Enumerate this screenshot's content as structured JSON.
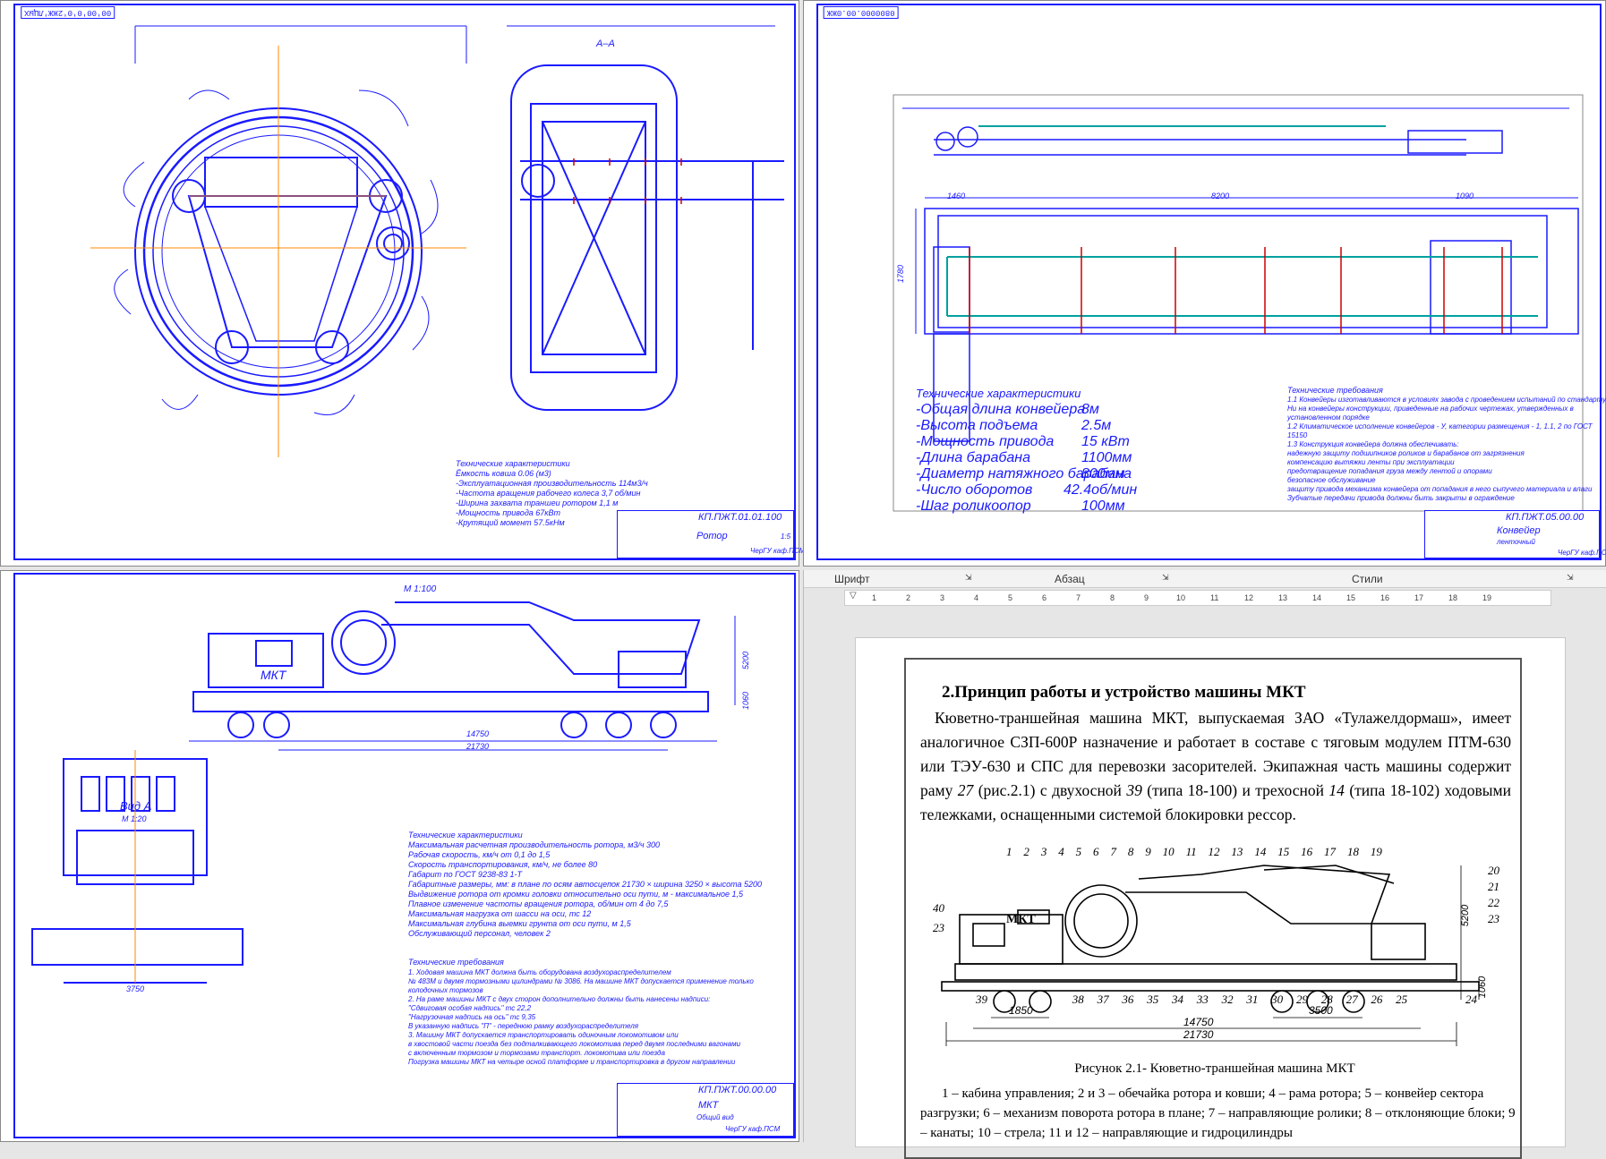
{
  "sheet1": {
    "stamp": "00'00'0'0'2ЖЖ'ЛЦЫХ",
    "section_label": "А–А",
    "title_code": "КП.ПЖТ.01.01.100",
    "title_name": "Ротор",
    "sheet_info": "ЧерГУ каф.ПСМ",
    "scale": "1:5",
    "specs_heading": "Технические характеристики",
    "specs": [
      "Ёмкость ковша     0.06 (м3)",
      "-Эксплуатационная производительность   114м3/ч",
      "-Частота вращения рабочего колеса 3,7 об/мин",
      "-Ширина захвата траншеи ротором 1,1 м",
      "-Мощность привода 67кВт",
      "-Крутящий момент 57.5кНм"
    ]
  },
  "sheet2": {
    "stamp": "0800000.00.0ЖЖ",
    "title_code": "КП.ПЖТ.05.00.00",
    "title_name": "Конвейер",
    "title_sub": "ленточный",
    "sheet_info": "ЧерГУ каф.ПСМ",
    "specs_heading": "Технические характеристики",
    "specs_rows": [
      {
        "label": "-Общая длина конвейера",
        "value": "8м"
      },
      {
        "label": "-Высота подъема",
        "value": "2.5м"
      },
      {
        "label": "-Мощность привода",
        "value": "15 кВт"
      },
      {
        "label": "-Длина барабана",
        "value": "1100мм"
      },
      {
        "label": "-Диаметр натяжного барабана",
        "value": "800мм"
      },
      {
        "label": "-Число оборотов",
        "value": "42.4об/мин"
      },
      {
        "label": "-Шаг роликоопор",
        "value": "100мм"
      }
    ],
    "req_heading": "Технические требования",
    "requirements": [
      "1.1 Конвейеры изготавливаются в условиях завода с проведением испытаний по стандарту и",
      "Ни на конвейеры конструкции, приведенные на рабочих чертежах, утвержденных в",
      "установленном порядке",
      "1.2 Климатическое исполнение конвейеров - У, категории размещения - 1, 1.1, 2 по ГОСТ",
      "15150",
      "1.3 Конструкция конвейера должна обеспечивать:",
      "надежную защиту подшипников роликов и барабанов от загрязнения",
      "компенсацию вытяжки ленты при эксплуатации",
      "предотвращение попадания груза между лентой и опорами",
      "безопасное обслуживание",
      "защиту привода механизма конвейера от попадания в него сыпучего материала и влаги",
      "Зубчатые передачи привода должны быть закрыты в ограждение"
    ],
    "dims": {
      "total": "8200",
      "left": "1460",
      "right": "1090",
      "height": "1780"
    }
  },
  "sheet3": {
    "top_scale": "М 1:100",
    "machine_label": "МКТ",
    "view_label": "Вид А",
    "view_scale": "М 1:20",
    "dims": {
      "total": "21730",
      "base": "14750",
      "height": "5200",
      "wheel": "1060",
      "view_width": "3750"
    },
    "title_code": "КП.ПЖТ.00.00.00",
    "title_name": "МКТ",
    "title_sub": "Общий вид",
    "sheet_info": "ЧерГУ каф.ПСМ",
    "specs_heading": "Технические характеристики",
    "specs": [
      "Максимальная расчетная производительность ротора, м3/ч 300",
      "Рабочая скорость, км/ч от 0,1 до 1,5",
      "Скорость транспортирования, км/ч, не более 80",
      "Габарит по ГОСТ 9238-83 1-Т",
      "Габаритные размеры, мм: в плане по осям автосцепок 21730 × ширина 3250 × высота 5200",
      "Выдвижение ротора от кромки головки относительно оси пути, м - максимальное 1,5",
      "Плавное изменение частоты вращения ротора, об/мин от 4 до 7,5",
      "Максимальная нагрузка от шасси на оси, тс 12",
      "Максимальная глубина выемки грунта от оси пути, м 1,5",
      "Обслуживающий персонал, человек   2"
    ],
    "req_heading": "Технические требования",
    "requirements": [
      "1. Ходовая машина МКТ должна быть оборудована воздухораспределителем",
      "№ 483М и двумя тормозными цилиндрами № 3086. На машине МКТ допускается применение только",
      "колодочных тормозов",
      "2. На раме машины МКТ с двух сторон дополнительно должны быть нанесены надписи:",
      "\"Сдвиговая особая надпись\"        тс 22,2",
      "\"Нагрузочная надпись на ось\"       тс 9,35",
      "В указанную надпись \"П\" - переднюю рамку воздухораспределителя",
      "3. Машину МКТ допускается транспортировать одиночным локомотивом или",
      "в хвостовой части поезда без подталкивающего локомотива перед двумя последними вагонами",
      "с включенным тормозом и тормозами транспорт. локомотива или поезда",
      "Погрузка машины МКТ на четыре осной платформе и транспортировка в другом направлении"
    ]
  },
  "word": {
    "ribbon": {
      "font": "Шрифт",
      "paragraph": "Абзац",
      "styles": "Стили"
    },
    "ruler_ticks": [
      "1",
      "2",
      "3",
      "4",
      "5",
      "6",
      "7",
      "8",
      "9",
      "10",
      "11",
      "12",
      "13",
      "14",
      "15",
      "16",
      "17",
      "18",
      "19"
    ],
    "heading": "2.Принцип работы и устройство машины МКТ",
    "paragraph_parts": [
      "Кюветно-траншейная машина МКТ, выпускаемая ЗАО «Тулажелдормаш», имеет аналогичное СЗП-600Р назначение и работает в составе с тяговым модулем ПТМ-630 или ТЭУ-630 и СПС для перевозки засорителей. Экипажная часть машины содержит раму ",
      "27",
      " (рис.2.1) с двухосной ",
      "39",
      " (типа 18-100) и трехосной ",
      "14",
      " (типа 18-102) ходовыми тележками, оснащенными системой блокировки рессор."
    ],
    "figure": {
      "machine_label": "МКТ",
      "dims": {
        "total": "21730",
        "base": "14750",
        "left": "1850",
        "right": "3500",
        "height": "5200",
        "wheel": "1060"
      },
      "top_numbers": [
        "1",
        "2",
        "3",
        "4",
        "5",
        "6",
        "7",
        "8",
        "9",
        "10",
        "11",
        "12",
        "13",
        "14",
        "15",
        "16",
        "17",
        "18",
        "19"
      ],
      "right_numbers": [
        "20",
        "21",
        "22",
        "23"
      ],
      "left_numbers": [
        "40",
        "23"
      ],
      "bottom_numbers": [
        "39",
        "38",
        "37",
        "36",
        "35",
        "34",
        "33",
        "32",
        "31",
        "30",
        "29",
        "28",
        "27",
        "26",
        "25",
        "24"
      ]
    },
    "caption": "Рисунок 2.1- Кюветно-траншейная машина МКТ",
    "legend": "1 – кабина управления; 2 и 3 – обечайка ротора и ковши; 4 – рама ротора; 5 – конвейер сектора разгрузки; 6 – механизм поворота ротора в плане; 7 – направляющие ролики; 8 – отклоняющие блоки; 9 – канаты; 10 – стрела; 11 и 12 – направляющие и гидроцилиндры"
  }
}
